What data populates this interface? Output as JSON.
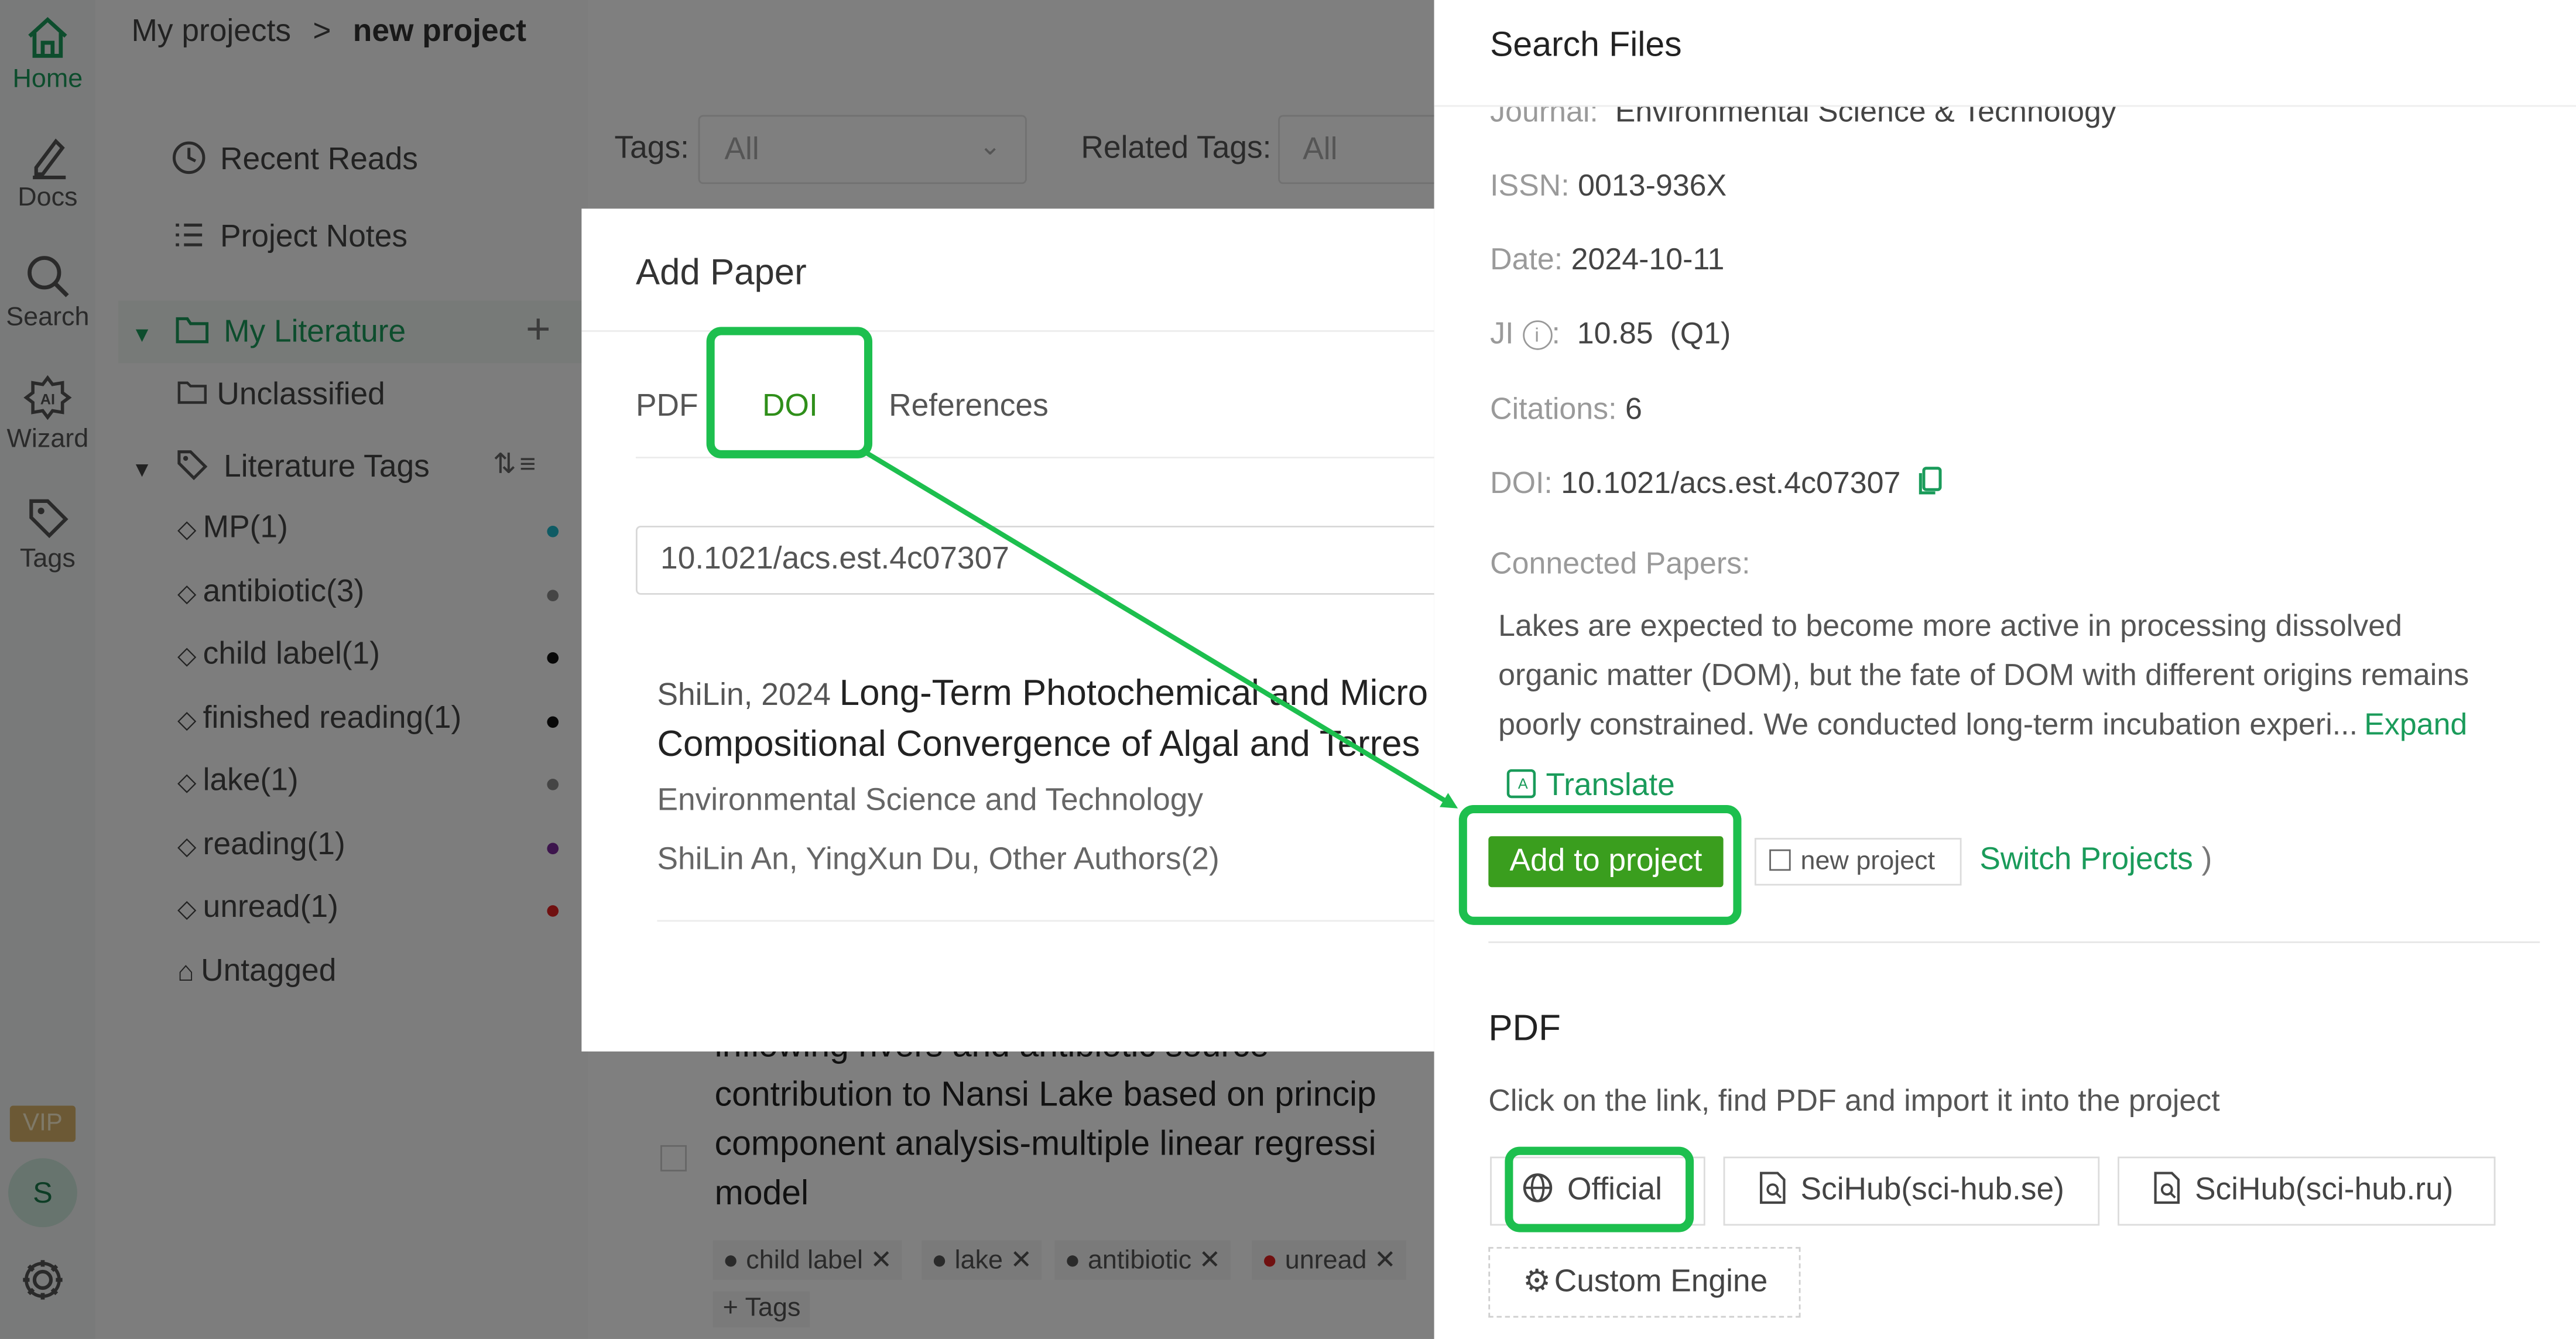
{
  "rail": {
    "items": [
      {
        "label": "Home",
        "icon": "home-icon"
      },
      {
        "label": "Docs",
        "icon": "docs-icon"
      },
      {
        "label": "Search",
        "icon": "search-icon"
      },
      {
        "label": "Wizard",
        "icon": "ai-wizard-icon"
      },
      {
        "label": "Tags",
        "icon": "tags-icon"
      }
    ],
    "vip_badge": "VIP",
    "avatar_letter": "S"
  },
  "breadcrumb": {
    "root": "My projects",
    "separator": ">",
    "current": "new project"
  },
  "sidebar": {
    "recent_reads": "Recent Reads",
    "project_notes": "Project Notes",
    "my_literature": "My Literature",
    "unclassified": "Unclassified",
    "literature_tags": "Literature Tags",
    "tags": [
      {
        "label": "MP(1)",
        "color": "#1fb6c8"
      },
      {
        "label": "antibiotic(3)",
        "color": "#8a8a8a"
      },
      {
        "label": "child label(1)",
        "color": "#111111"
      },
      {
        "label": "finished reading(1)",
        "color": "#111111"
      },
      {
        "label": "lake(1)",
        "color": "#8a8a8a"
      },
      {
        "label": "reading(1)",
        "color": "#7a2a9a"
      },
      {
        "label": "unread(1)",
        "color": "#e02020"
      }
    ],
    "untagged": "Untagged"
  },
  "filters": {
    "tags_label": "Tags:",
    "tags_value": "All",
    "related_label": "Related Tags:",
    "related_value": "All"
  },
  "bg_paper": {
    "title_lines": [
      "inflowing rivers and antibiotic source",
      "contribution to Nansi Lake based on princip",
      "component analysis-multiple linear regressi",
      "model"
    ],
    "chips": [
      "child label",
      "lake",
      "antibiotic",
      "unread"
    ],
    "add_tags": "Tags"
  },
  "dialog": {
    "title": "Add Paper",
    "tabs": [
      "PDF",
      "DOI",
      "References"
    ],
    "input_value": "10.1021/acs.est.4c07307",
    "result": {
      "author_year": "ShiLin, 2024",
      "title_line1": "Long-Term Photochemical and Micro",
      "title_line2": "Compositional Convergence of Algal and Terres",
      "journal": "Environmental Science and Technology",
      "authors": "ShiLin An, YingXun Du, Other Authors(2)"
    }
  },
  "panel": {
    "title": "Search Files",
    "journal_label": "Journal:",
    "journal_value": "Environmental Science & Technology",
    "issn_label": "ISSN:",
    "issn_value": "0013-936X",
    "date_label": "Date:",
    "date_value": "2024-10-11",
    "ji_label": "JI",
    "ji_value": "10.85",
    "ji_quartile": "(Q1)",
    "citations_label": "Citations:",
    "citations_value": "6",
    "doi_label": "DOI:",
    "doi_value": "10.1021/acs.est.4c07307",
    "connected_label": "Connected Papers:",
    "abstract_lines": [
      "Lakes are expected to become more active in processing dissolved",
      "organic matter (DOM), but the fate of DOM with different origins remains",
      "poorly constrained. We conducted long-term incubation experi..."
    ],
    "expand": "Expand",
    "translate": "Translate",
    "add_to_project": "Add to project",
    "project_name": "new project",
    "switch_projects": "Switch Projects",
    "switch_paren": ")",
    "pdf_heading": "PDF",
    "pdf_hint": "Click on the link, find PDF and import it into the project",
    "sources": {
      "official": "Official",
      "scihub_se": "SciHub(sci-hub.se)",
      "scihub_ru": "SciHub(sci-hub.ru)",
      "custom": "Custom Engine"
    }
  },
  "colors": {
    "accent": "#1a9b5a",
    "highlight": "#1dbf4e",
    "primary_button": "#3a9e1e"
  }
}
